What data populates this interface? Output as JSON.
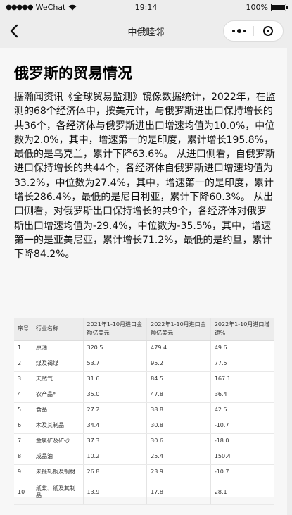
{
  "status_bar": {
    "carrier": "WeChat",
    "time": "19:14",
    "battery_text": "100%",
    "battery_level": 1.0
  },
  "navbar": {
    "title": "中俄睦邻"
  },
  "article": {
    "title": "俄罗斯的贸易情况",
    "body": "据瀚闻资讯《全球贸易监测》镜像数据统计，2022年，在监测的68个经济体中，按美元计，与俄罗斯进出口保持增长的共36个，各经济体与俄罗斯进出口增速均值为10.0%，中位数为2.0%，其中，增速第一的是印度，累计增长195.8%，最低的是乌克兰，累计下降63.6%。 从进口侧看，自俄罗斯进口保持增长的共44个，各经济体自俄罗斯进口增速均值为33.2%，中位数为27.4%，其中，增速第一的是印度，累计增长286.4%，最低的是尼日利亚，累计下降60.3%。 从出口侧看，对俄罗斯出口保持增长的共9个，各经济体对俄罗斯出口增速均值为-29.4%，中位数为-35.5%，其中，增速第一的是亚美尼亚，累计增长71.2%，最低的是约旦，累计下降84.2%。"
  },
  "table": {
    "headers": [
      "序号",
      "行业名称",
      "2021年1-10月进口金额亿美元",
      "2022年1-10月进口金额亿美元",
      "2022年1-10月进口增速%"
    ],
    "rows": [
      [
        "1",
        "原油",
        "320.5",
        "479.4",
        "49.6"
      ],
      [
        "2",
        "煤及褐煤",
        "53.7",
        "95.2",
        "77.5"
      ],
      [
        "3",
        "天然气",
        "31.6",
        "84.5",
        "167.1"
      ],
      [
        "4",
        "农产品*",
        "35.0",
        "47.8",
        "36.4"
      ],
      [
        "5",
        "食品",
        "27.2",
        "38.8",
        "42.5"
      ],
      [
        "6",
        "木及其制品",
        "34.4",
        "30.8",
        "-10.7"
      ],
      [
        "7",
        "金属矿及矿砂",
        "37.3",
        "30.6",
        "-18.0"
      ],
      [
        "8",
        "成品油",
        "10.2",
        "25.4",
        "150.4"
      ],
      [
        "9",
        "未锻轧铜及铜材",
        "26.8",
        "23.9",
        "-10.7"
      ],
      [
        "10",
        "纸浆、纸及其制品",
        "13.9",
        "17.8",
        "28.1"
      ]
    ]
  }
}
